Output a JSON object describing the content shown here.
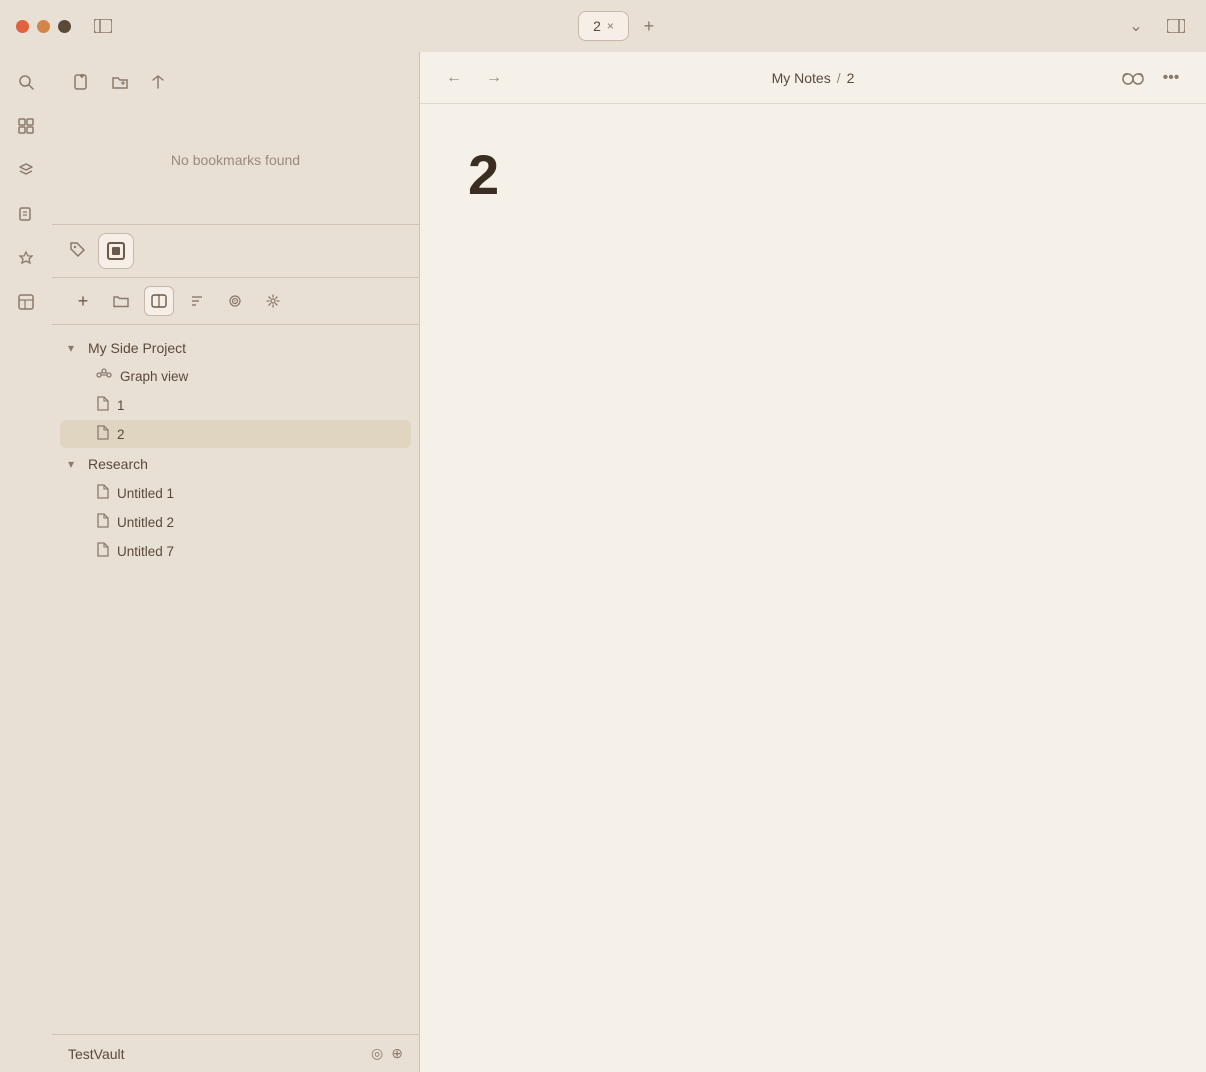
{
  "titlebar": {
    "tab_label": "2",
    "tab_close": "×",
    "tab_add": "+",
    "chevron_down": "⌄",
    "toggle_icon": "⊟"
  },
  "sidebar": {
    "bookmarks_empty": "No bookmarks found",
    "icons": [
      {
        "name": "search",
        "symbol": "⌕"
      },
      {
        "name": "grid",
        "symbol": "⊞"
      },
      {
        "name": "layers",
        "symbol": "≡"
      },
      {
        "name": "pages",
        "symbol": "◫"
      },
      {
        "name": "puzzle",
        "symbol": "✦"
      },
      {
        "name": "layout",
        "symbol": "▤"
      }
    ]
  },
  "panel": {
    "vault_toolbar": [
      {
        "name": "add",
        "symbol": "+"
      },
      {
        "name": "folder",
        "symbol": "⊡"
      },
      {
        "name": "columns",
        "symbol": "⊟"
      },
      {
        "name": "sort",
        "symbol": "⇅"
      },
      {
        "name": "target",
        "symbol": "◎"
      },
      {
        "name": "sparkle",
        "symbol": "✦"
      }
    ],
    "sections": [
      {
        "name": "My Side Project",
        "expanded": true,
        "items": [
          {
            "type": "graph",
            "label": "Graph view"
          },
          {
            "type": "file",
            "label": "1",
            "active": false
          },
          {
            "type": "file",
            "label": "2",
            "active": true
          }
        ]
      },
      {
        "name": "Research",
        "expanded": true,
        "items": [
          {
            "type": "file",
            "label": "Untitled 1",
            "active": false
          },
          {
            "type": "file",
            "label": "Untitled 2",
            "active": false
          },
          {
            "type": "file",
            "label": "Untitled 7",
            "active": false
          }
        ]
      }
    ],
    "vault_footer": {
      "name": "TestVault"
    }
  },
  "content": {
    "breadcrumb_parent": "My Notes",
    "breadcrumb_sep": "/",
    "breadcrumb_current": "2",
    "note_content": "2"
  }
}
